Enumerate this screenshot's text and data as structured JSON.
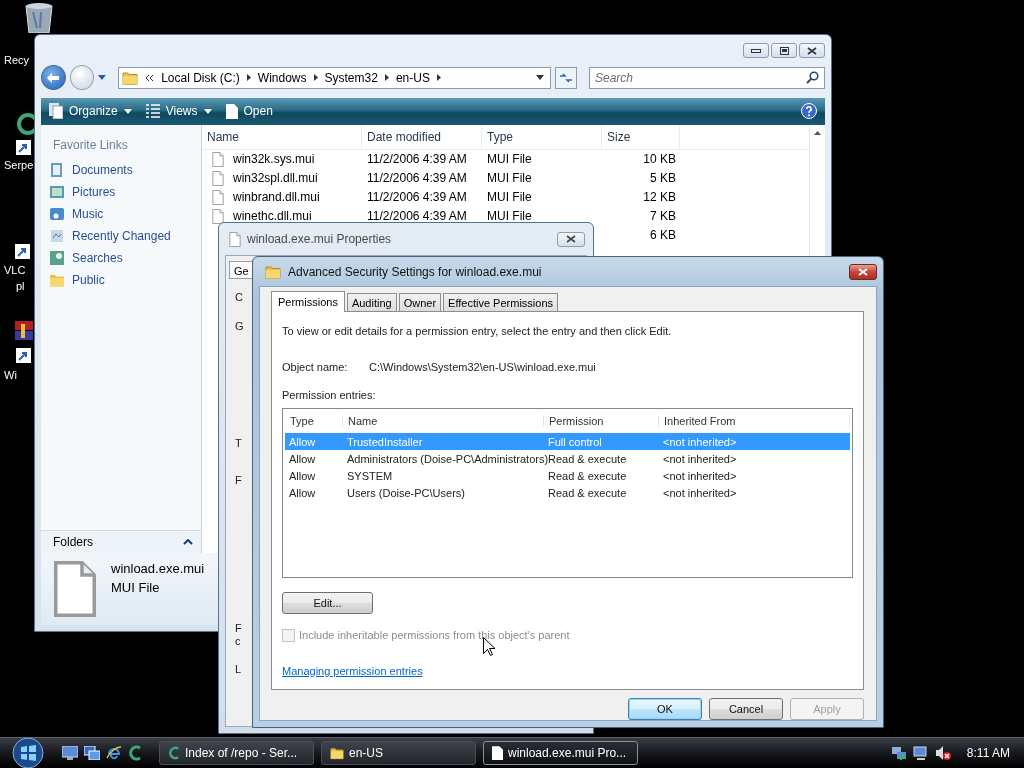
{
  "desktop_icons": [
    {
      "lines": [
        "Recy"
      ]
    },
    {
      "lines": [
        "Serpe"
      ]
    },
    {
      "lines": [
        "VLC",
        "pl"
      ]
    },
    {
      "lines": [
        "Wi"
      ]
    }
  ],
  "explorer": {
    "breadcrumbs": [
      "Local Disk (C:)",
      "Windows",
      "System32",
      "en-US"
    ],
    "search": {
      "placeholder": "Search"
    },
    "toolbar": [
      {
        "label": "Organize",
        "dropdown": true
      },
      {
        "label": "Views",
        "dropdown": true
      },
      {
        "label": "Open",
        "dropdown": false
      }
    ],
    "favorite_links": {
      "title": "Favorite Links",
      "items": [
        "Documents",
        "Pictures",
        "Music",
        "Recently Changed",
        "Searches",
        "Public"
      ]
    },
    "folders_label": "Folders",
    "columns": [
      "Name",
      "Date modified",
      "Type",
      "Size"
    ],
    "rows": [
      {
        "name": "win32k.sys.mui",
        "date": "11/2/2006 4:39 AM",
        "type": "MUI File",
        "size": "10 KB"
      },
      {
        "name": "win32spl.dll.mui",
        "date": "11/2/2006 4:39 AM",
        "type": "MUI File",
        "size": "5 KB"
      },
      {
        "name": "winbrand.dll.mui",
        "date": "11/2/2006 4:39 AM",
        "type": "MUI File",
        "size": "12 KB"
      },
      {
        "name": "winethc.dll.mui",
        "date": "11/2/2006 4:39 AM",
        "type": "MUI File",
        "size": "7 KB"
      },
      {
        "size": "6 KB"
      }
    ],
    "details": {
      "name": "winload.exe.mui",
      "type": "MUI File"
    }
  },
  "properties_dialog": {
    "title": "winload.exe.mui Properties",
    "tab": "Ge",
    "fragments": [
      "C",
      "G",
      "T",
      "F",
      "F",
      "c",
      "L"
    ]
  },
  "security_dialog": {
    "title": "Advanced Security Settings for winload.exe.mui",
    "tabs": [
      {
        "label": "Permissions",
        "selected": true
      },
      {
        "label": "Auditing",
        "selected": false
      },
      {
        "label": "Owner",
        "selected": false
      },
      {
        "label": "Effective Permissions",
        "selected": false
      }
    ],
    "intro": "To view or edit details for a permission entry, select the entry and then click Edit.",
    "object_name": {
      "label": "Object name:",
      "value": "C:\\Windows\\System32\\en-US\\winload.exe.mui"
    },
    "entries_label": "Permission entries:",
    "columns": [
      "Type",
      "Name",
      "Permission",
      "Inherited From"
    ],
    "entries": [
      {
        "type": "Allow",
        "name": "TrustedInstaller",
        "permission": "Full control",
        "inherited_from": "<not inherited>",
        "selected": true
      },
      {
        "type": "Allow",
        "name": "Administrators (Doise-PC\\Administrators)",
        "permission": "Read & execute",
        "inherited_from": "<not inherited>",
        "selected": false
      },
      {
        "type": "Allow",
        "name": "SYSTEM",
        "permission": "Read & execute",
        "inherited_from": "<not inherited>",
        "selected": false
      },
      {
        "type": "Allow",
        "name": "Users (Doise-PC\\Users)",
        "permission": "Read & execute",
        "inherited_from": "<not inherited>",
        "selected": false
      }
    ],
    "edit_button": "Edit...",
    "inherit_checkbox": {
      "label": "Include inheritable permissions from this object's parent",
      "checked": false,
      "disabled": true
    },
    "help_link": "Managing permission entries",
    "buttons": [
      {
        "label": "OK",
        "default": true,
        "disabled": false
      },
      {
        "label": "Cancel",
        "default": false,
        "disabled": false
      },
      {
        "label": "Apply",
        "default": false,
        "disabled": true
      }
    ]
  },
  "taskbar": {
    "tasks": [
      {
        "label": "Index of /repo - Ser...",
        "selected": false
      },
      {
        "label": "en-US",
        "selected": false
      },
      {
        "label": "winload.exe.mui Pro...",
        "selected": true
      }
    ],
    "clock": "8:11 AM"
  }
}
